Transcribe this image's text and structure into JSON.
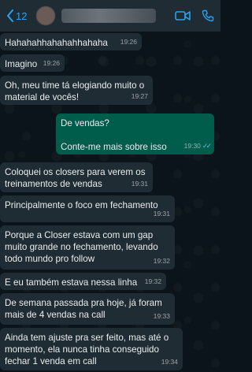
{
  "header": {
    "back_count": "12",
    "icons": [
      "chevron-left-icon",
      "video-camera-icon",
      "phone-icon"
    ]
  },
  "messages": [
    {
      "direction": "in",
      "text": "Hahahahhahahahhahaha",
      "time": "19:26"
    },
    {
      "direction": "in",
      "text": "Imagino",
      "time": "19:26"
    },
    {
      "direction": "in",
      "text": "Oh, meu time tá elogiando muito o\nmaterial de vocês!",
      "time": "19:27"
    },
    {
      "direction": "out",
      "text": "De vendas?\n\nConte-me mais sobre isso",
      "time": "19:30",
      "status": "read"
    },
    {
      "direction": "in",
      "text": "Coloquei os closers para verem os\ntreinamentos de vendas",
      "time": "19:31"
    },
    {
      "direction": "in",
      "text": "Principalmente o foco em fechamento",
      "time": "19:31"
    },
    {
      "direction": "in",
      "text": "Porque a Closer estava com um gap\nmuito grande no fechamento, levando\ntodo mundo pro follow",
      "time": "19:32"
    },
    {
      "direction": "in",
      "text": "E eu também estava nessa linha",
      "time": "19:32"
    },
    {
      "direction": "in",
      "text": "De semana passada pra hoje, já foram\nmais de 4 vendas na call",
      "time": "19:33"
    },
    {
      "direction": "in",
      "text": "Ainda tem ajuste pra ser feito, mas até o\nmomento, ela nunca tinha conseguido\nfechar 1 venda em call",
      "time": "19:34"
    }
  ]
}
